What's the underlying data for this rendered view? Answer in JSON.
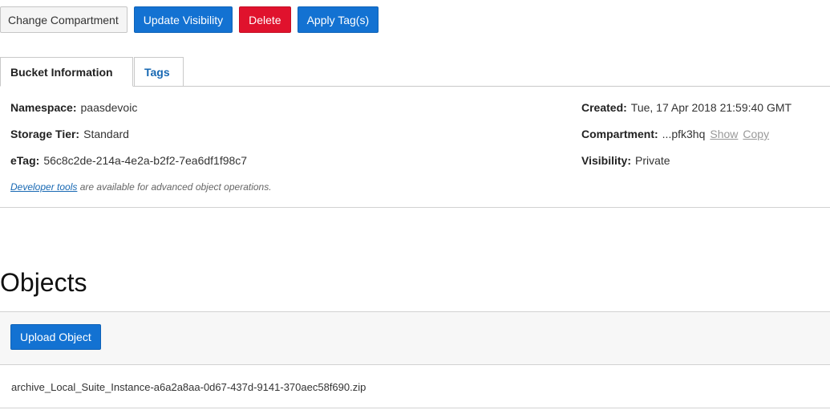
{
  "toolbar": {
    "change_compartment": "Change Compartment",
    "update_visibility": "Update Visibility",
    "delete": "Delete",
    "apply_tags": "Apply Tag(s)"
  },
  "tabs": [
    {
      "label": "Bucket Information",
      "active": true
    },
    {
      "label": "Tags",
      "active": false
    }
  ],
  "bucket": {
    "namespace_label": "Namespace:",
    "namespace": "paasdevoic",
    "storage_tier_label": "Storage Tier:",
    "storage_tier": "Standard",
    "etag_label": "eTag:",
    "etag": "56c8c2de-214a-4e2a-b2f2-7ea6df1f98c7",
    "created_label": "Created:",
    "created": "Tue, 17 Apr 2018 21:59:40 GMT",
    "compartment_label": "Compartment:",
    "compartment": "...pfk3hq",
    "show_link": "Show",
    "copy_link": "Copy",
    "visibility_label": "Visibility:",
    "visibility": "Private",
    "dev_tools_link": "Developer tools",
    "dev_tools_text": " are available for advanced object operations."
  },
  "objects": {
    "title": "Objects",
    "upload_button": "Upload Object",
    "items": [
      {
        "name": "archive_Local_Suite_Instance-a6a2a8aa-0d67-437d-9141-370aec58f690.zip"
      }
    ]
  },
  "colors": {
    "primary": "#1372d2",
    "danger": "#e0122d",
    "link": "#1768b3"
  }
}
